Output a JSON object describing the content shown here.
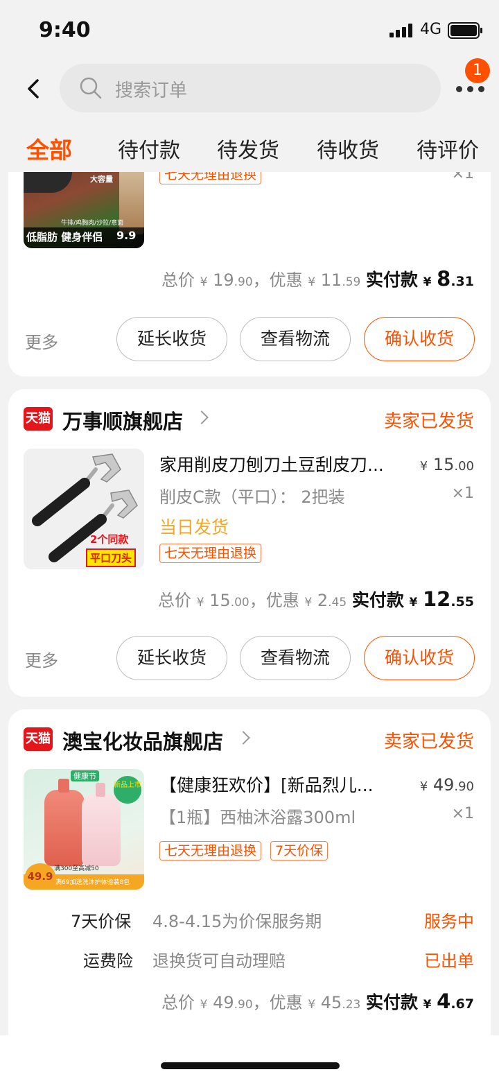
{
  "status_bar": {
    "time": "9:40",
    "network": "4G"
  },
  "header": {
    "search_placeholder": "搜索订单",
    "badge_count": "1"
  },
  "tabs": [
    "全部",
    "待付款",
    "待发货",
    "待收货",
    "待评价"
  ],
  "orders": [
    {
      "tags": [
        "七天无理由退换"
      ],
      "qty": "×1",
      "thumb_text": [
        "大容量",
        "牛排/鸡胸肉/沙拉/意面",
        "低脂肪 健身伴侣",
        "9.9"
      ],
      "totals": {
        "total_label": "总价",
        "total_int": "19",
        "total_dec": ".90",
        "discount_label": "，优惠",
        "discount_int": "11",
        "discount_dec": ".59",
        "pay_label": "实付款",
        "pay_int": "8",
        "pay_dec": ".31"
      },
      "actions": {
        "more": "更多",
        "extend": "延长收货",
        "logistics": "查看物流",
        "confirm": "确认收货"
      }
    },
    {
      "shop_badge": "天猫",
      "shop_name": "万事顺旗舰店",
      "status": "卖家已发货",
      "title": "家用削皮刀刨刀土豆刮皮刀...",
      "price_int": "15",
      "price_dec": ".00",
      "sku": "削皮C款（平口）： 2把装",
      "qty": "×1",
      "shipping": "当日发货",
      "tags": [
        "七天无理由退换"
      ],
      "thumb_text": [
        "2个同款",
        "平口刀头"
      ],
      "totals": {
        "total_label": "总价",
        "total_int": "15",
        "total_dec": ".00",
        "discount_label": "，优惠",
        "discount_int": "2",
        "discount_dec": ".45",
        "pay_label": "实付款",
        "pay_int": "12",
        "pay_dec": ".55"
      },
      "actions": {
        "more": "更多",
        "extend": "延长收货",
        "logistics": "查看物流",
        "confirm": "确认收货"
      }
    },
    {
      "shop_badge": "天猫",
      "shop_name": "澳宝化妆品旗舰店",
      "status": "卖家已发货",
      "title": "【健康狂欢价】[新品烈儿...",
      "price_int": "49",
      "price_dec": ".90",
      "sku": "【1瓶】西柚沐浴露300ml",
      "qty": "×1",
      "tags": [
        "七天无理由退换",
        "7天价保"
      ],
      "thumb_text": [
        "健康节",
        "新品上市",
        "满300至高减50",
        "满69加送洗沐护体验装8包",
        "49.9"
      ],
      "services": [
        {
          "label": "7天价保",
          "desc": "4.8-4.15为价保服务期",
          "state": "服务中"
        },
        {
          "label": "运费险",
          "desc": "退换货可自动理赔",
          "state": "已出单"
        }
      ],
      "totals": {
        "total_label": "总价",
        "total_int": "49",
        "total_dec": ".90",
        "discount_label": "，优惠",
        "discount_int": "45",
        "discount_dec": ".23",
        "pay_label": "实付款",
        "pay_int": "4",
        "pay_dec": ".67"
      }
    }
  ],
  "currency": "¥",
  "colors": {
    "accent": "#ff5000",
    "tmall": "#e3161c",
    "shipping": "#f5a623"
  }
}
